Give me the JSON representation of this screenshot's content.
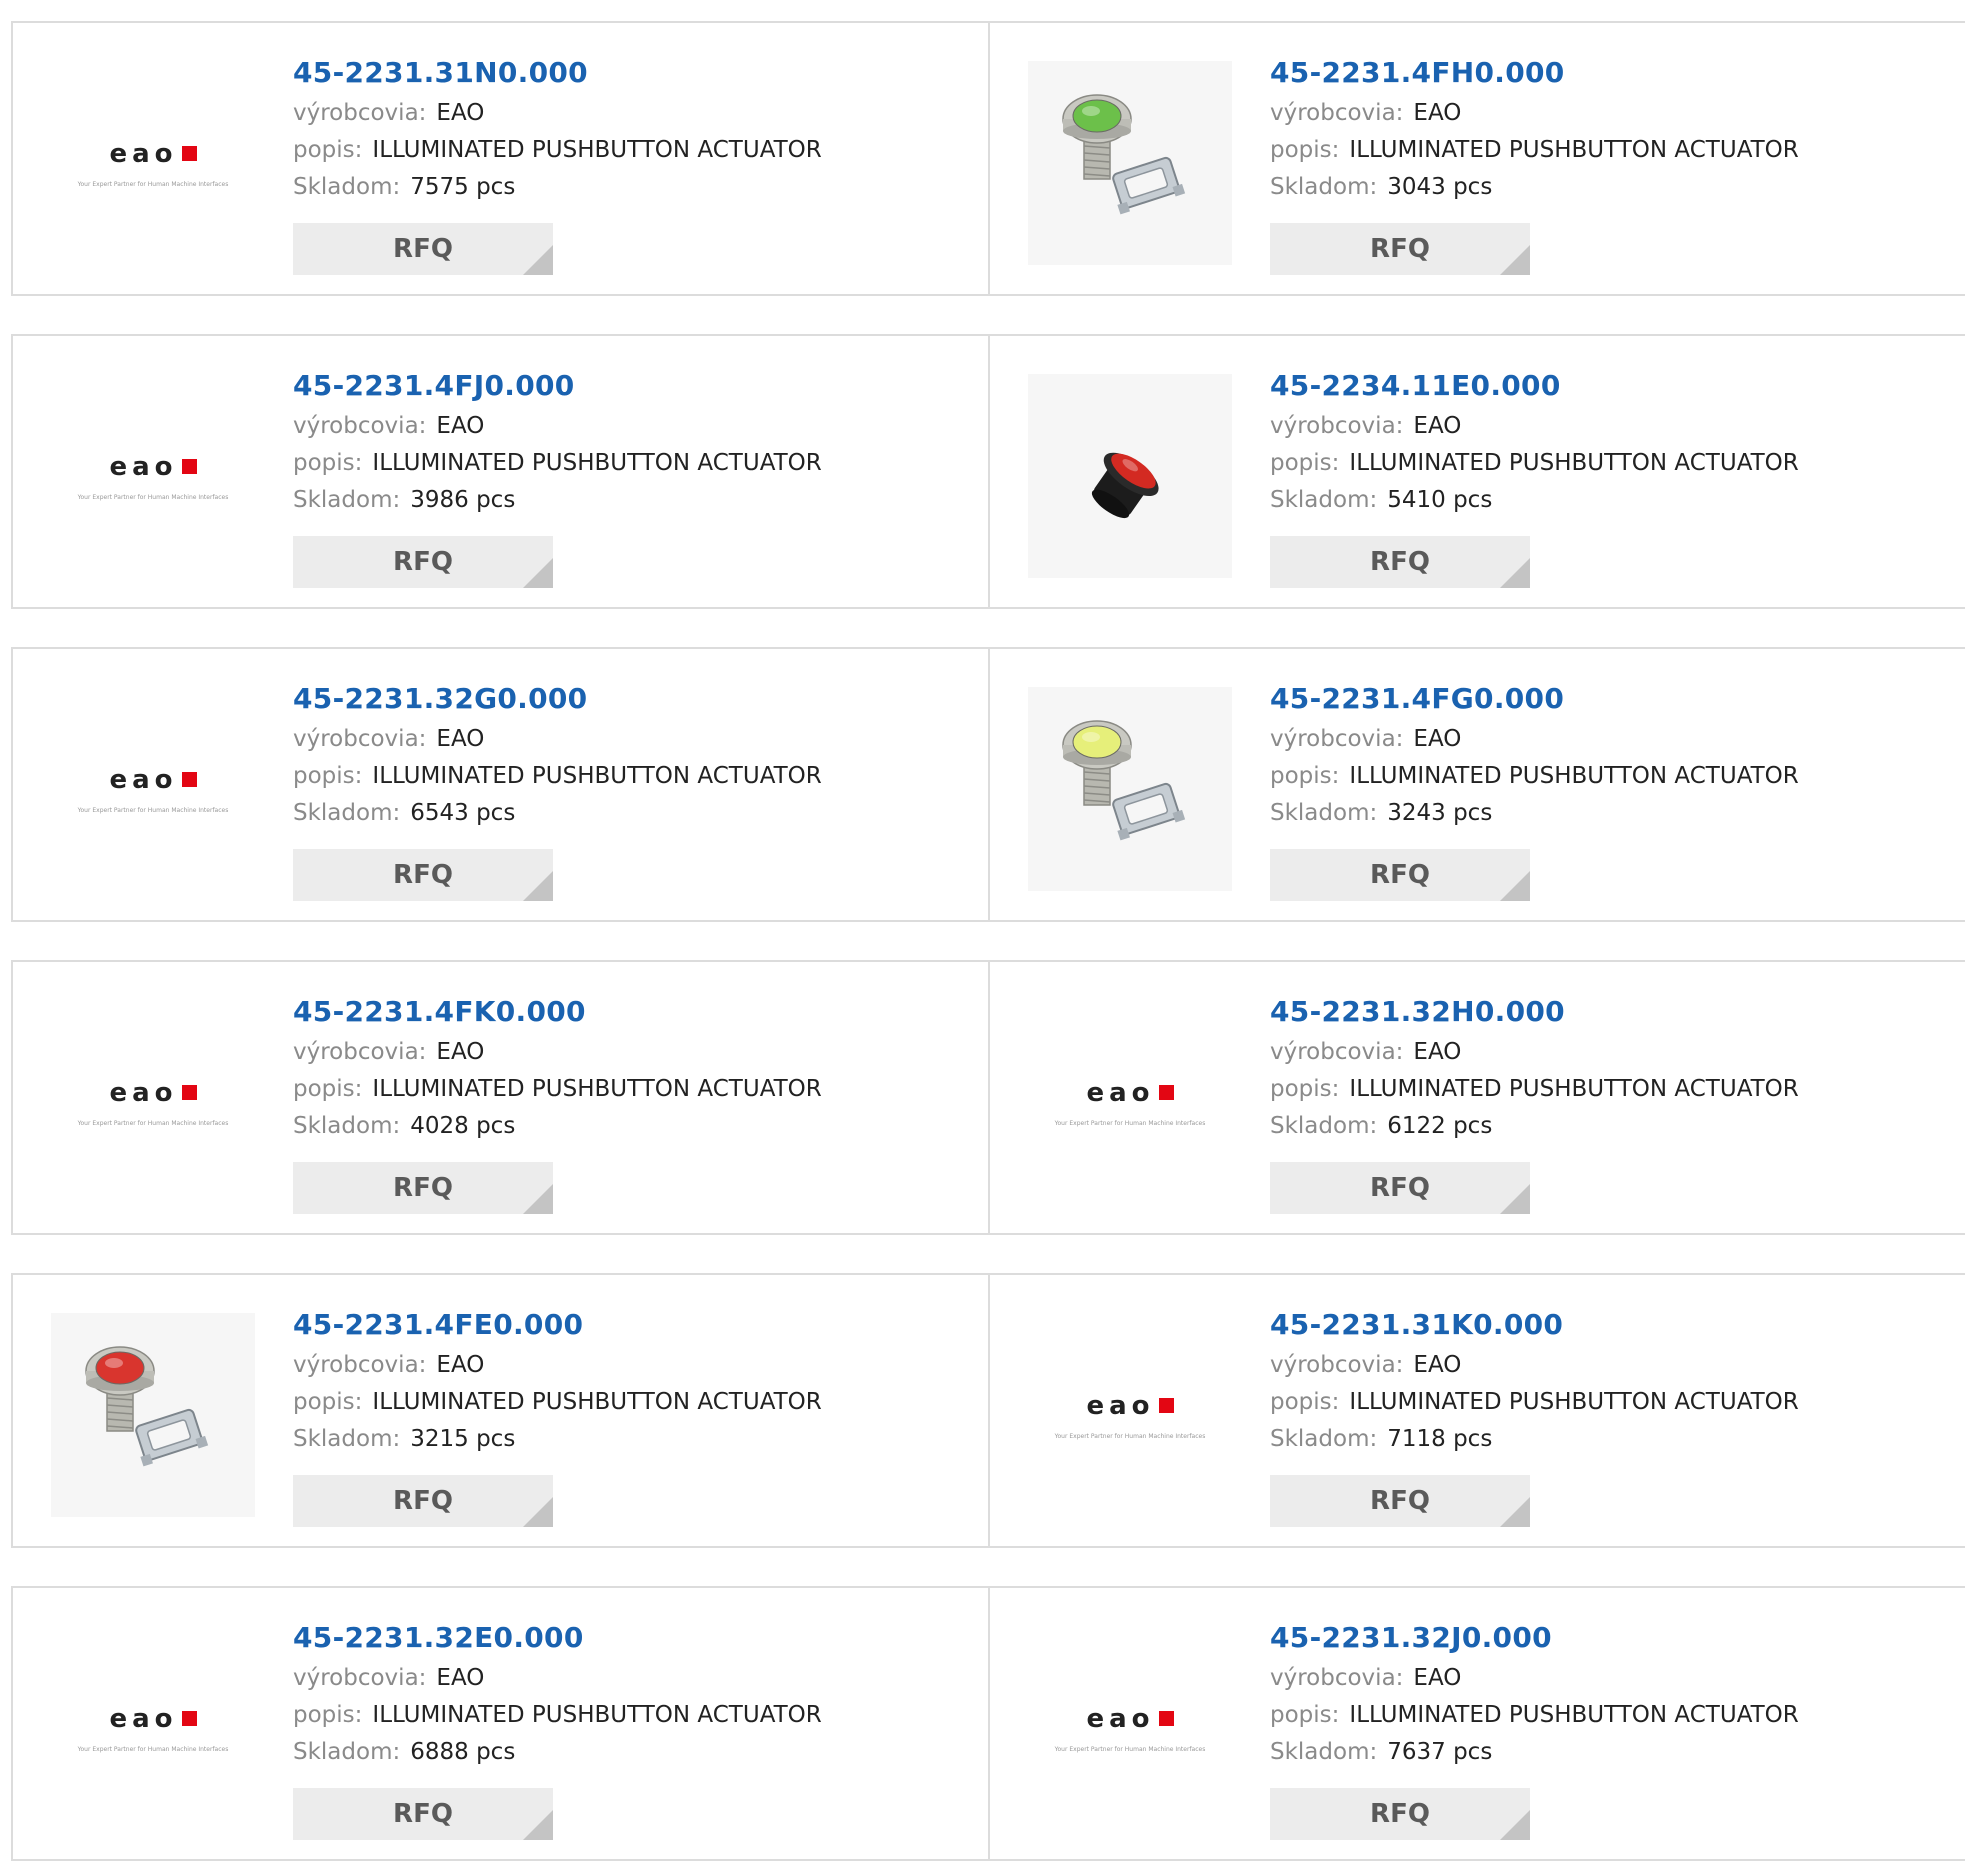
{
  "labels": {
    "manufacturer": "výrobcovia:",
    "description": "popis:",
    "stock": "Skladom:",
    "rfq": "RFQ"
  },
  "logo": {
    "wordmark": "eao",
    "tagline": "Your Expert Partner for Human Machine Interfaces",
    "accent_color": "#e30613"
  },
  "products": [
    {
      "part": "45-2231.31N0.000",
      "manufacturer": "EAO",
      "description": "ILLUMINATED PUSHBUTTON ACTUATOR",
      "stock": "7575 pcs",
      "image": "eao-logo"
    },
    {
      "part": "45-2231.4FH0.000",
      "manufacturer": "EAO",
      "description": "ILLUMINATED PUSHBUTTON ACTUATOR",
      "stock": "3043 pcs",
      "image": "green-pushbutton-with-bracket"
    },
    {
      "part": "45-2231.4FJ0.000",
      "manufacturer": "EAO",
      "description": "ILLUMINATED PUSHBUTTON ACTUATOR",
      "stock": "3986 pcs",
      "image": "eao-logo"
    },
    {
      "part": "45-2234.11E0.000",
      "manufacturer": "EAO",
      "description": "ILLUMINATED PUSHBUTTON ACTUATOR",
      "stock": "5410 pcs",
      "image": "red-pushbutton-black-body"
    },
    {
      "part": "45-2231.32G0.000",
      "manufacturer": "EAO",
      "description": "ILLUMINATED PUSHBUTTON ACTUATOR",
      "stock": "6543 pcs",
      "image": "eao-logo"
    },
    {
      "part": "45-2231.4FG0.000",
      "manufacturer": "EAO",
      "description": "ILLUMINATED PUSHBUTTON ACTUATOR",
      "stock": "3243 pcs",
      "image": "yellow-pushbutton-with-bracket"
    },
    {
      "part": "45-2231.4FK0.000",
      "manufacturer": "EAO",
      "description": "ILLUMINATED PUSHBUTTON ACTUATOR",
      "stock": "4028 pcs",
      "image": "eao-logo"
    },
    {
      "part": "45-2231.32H0.000",
      "manufacturer": "EAO",
      "description": "ILLUMINATED PUSHBUTTON ACTUATOR",
      "stock": "6122 pcs",
      "image": "eao-logo"
    },
    {
      "part": "45-2231.4FE0.000",
      "manufacturer": "EAO",
      "description": "ILLUMINATED PUSHBUTTON ACTUATOR",
      "stock": "3215 pcs",
      "image": "red-pushbutton-with-bracket"
    },
    {
      "part": "45-2231.31K0.000",
      "manufacturer": "EAO",
      "description": "ILLUMINATED PUSHBUTTON ACTUATOR",
      "stock": "7118 pcs",
      "image": "eao-logo"
    },
    {
      "part": "45-2231.32E0.000",
      "manufacturer": "EAO",
      "description": "ILLUMINATED PUSHBUTTON ACTUATOR",
      "stock": "6888 pcs",
      "image": "eao-logo"
    },
    {
      "part": "45-2231.32J0.000",
      "manufacturer": "EAO",
      "description": "ILLUMINATED PUSHBUTTON ACTUATOR",
      "stock": "7637 pcs",
      "image": "eao-logo"
    }
  ],
  "image_colors": {
    "green-pushbutton-with-bracket": "#6cc04a",
    "yellow-pushbutton-with-bracket": "#e6ef7a",
    "red-pushbutton-with-bracket": "#d9352e",
    "red-pushbutton-black-body": "#d32a22"
  }
}
